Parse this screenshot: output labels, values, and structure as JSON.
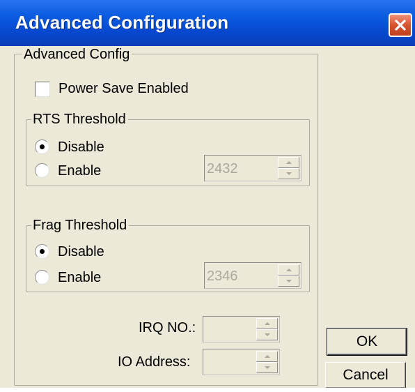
{
  "window": {
    "title": "Advanced Configuration"
  },
  "advanced_config": {
    "group_label": "Advanced Config",
    "power_save_label": "Power Save Enabled",
    "power_save_checked": false
  },
  "rts_threshold": {
    "group_label": "RTS Threshold",
    "disable_label": "Disable",
    "enable_label": "Enable",
    "selected": "Disable",
    "value": "2432"
  },
  "frag_threshold": {
    "group_label": "Frag Threshold",
    "disable_label": "Disable",
    "enable_label": "Enable",
    "selected": "Disable",
    "value": "2346"
  },
  "irq": {
    "label": "IRQ NO.:",
    "value": ""
  },
  "io_address": {
    "label": "IO Address:",
    "value": ""
  },
  "buttons": {
    "ok": "OK",
    "cancel": "Cancel"
  },
  "icons": {
    "close": "close-x-icon",
    "up": "arrow-up-icon",
    "down": "arrow-down-icon"
  },
  "colors": {
    "titlebar": "#0a5be0",
    "dialog_bg": "#ece9d8",
    "close_button": "#d8532f"
  }
}
